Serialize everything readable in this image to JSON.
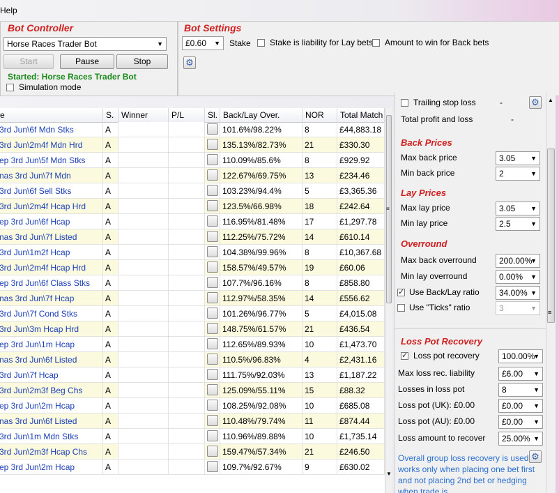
{
  "menu": {
    "help": "Help"
  },
  "bot_controller": {
    "title": "Bot Controller",
    "bot_select": "Horse Races Trader Bot",
    "start": "Start",
    "pause": "Pause",
    "stop": "Stop",
    "status": "Started: Horse Races Trader Bot",
    "simulation": "Simulation mode"
  },
  "bot_settings": {
    "title": "Bot Settings",
    "stake_value": "£0.60",
    "stake_label": "Stake",
    "liability_label": "Stake is liability for Lay bets",
    "amount_label": "Amount to win for Back bets"
  },
  "grid": {
    "headers": [
      "e",
      "S.",
      "Winner",
      "P/L",
      "Sl.",
      "Back/Lay Over.",
      "NOR",
      "Total Match"
    ],
    "rows": [
      {
        "name": "3rd Jun\\6f Mdn Stks",
        "s": "A",
        "over": "101.6%/98.22%",
        "nor": "8",
        "total": "£44,883.18"
      },
      {
        "name": "3rd Jun\\2m4f Mdn Hrd",
        "s": "A",
        "over": "135.13%/82.73%",
        "nor": "21",
        "total": "£330.30"
      },
      {
        "name": "ep 3rd Jun\\5f Mdn Stks",
        "s": "A",
        "over": "110.09%/85.6%",
        "nor": "8",
        "total": "£929.92"
      },
      {
        "name": "nas 3rd Jun\\7f Mdn",
        "s": "A",
        "over": "122.67%/69.75%",
        "nor": "13",
        "total": "£234.46"
      },
      {
        "name": "3rd Jun\\6f Sell Stks",
        "s": "A",
        "over": "103.23%/94.4%",
        "nor": "5",
        "total": "£3,365.36"
      },
      {
        "name": "3rd Jun\\2m4f Hcap Hrd",
        "s": "A",
        "over": "123.5%/66.98%",
        "nor": "18",
        "total": "£242.64"
      },
      {
        "name": "ep 3rd Jun\\6f Hcap",
        "s": "A",
        "over": "116.95%/81.48%",
        "nor": "17",
        "total": "£1,297.78"
      },
      {
        "name": "nas 3rd Jun\\7f Listed",
        "s": "A",
        "over": "112.25%/75.72%",
        "nor": "14",
        "total": "£610.14"
      },
      {
        "name": "3rd Jun\\1m2f Hcap",
        "s": "A",
        "over": "104.38%/99.96%",
        "nor": "8",
        "total": "£10,367.68"
      },
      {
        "name": "3rd Jun\\2m4f Hcap Hrd",
        "s": "A",
        "over": "158.57%/49.57%",
        "nor": "19",
        "total": "£60.06"
      },
      {
        "name": "ep 3rd Jun\\6f Class Stks",
        "s": "A",
        "over": "107.7%/96.16%",
        "nor": "8",
        "total": "£858.80"
      },
      {
        "name": "nas 3rd Jun\\7f Hcap",
        "s": "A",
        "over": "112.97%/58.35%",
        "nor": "14",
        "total": "£556.62"
      },
      {
        "name": "3rd Jun\\7f Cond Stks",
        "s": "A",
        "over": "101.26%/96.77%",
        "nor": "5",
        "total": "£4,015.08"
      },
      {
        "name": "3rd Jun\\3m Hcap Hrd",
        "s": "A",
        "over": "148.75%/61.57%",
        "nor": "21",
        "total": "£436.54"
      },
      {
        "name": "ep 3rd Jun\\1m Hcap",
        "s": "A",
        "over": "112.65%/89.93%",
        "nor": "10",
        "total": "£1,473.70"
      },
      {
        "name": "nas 3rd Jun\\6f Listed",
        "s": "A",
        "over": "110.5%/96.83%",
        "nor": "4",
        "total": "£2,431.16"
      },
      {
        "name": "3rd Jun\\7f Hcap",
        "s": "A",
        "over": "111.75%/92.03%",
        "nor": "13",
        "total": "£1,187.22"
      },
      {
        "name": "3rd Jun\\2m3f Beg Chs",
        "s": "A",
        "over": "125.09%/55.11%",
        "nor": "15",
        "total": "£88.32"
      },
      {
        "name": "ep 3rd Jun\\2m Hcap",
        "s": "A",
        "over": "108.25%/92.08%",
        "nor": "10",
        "total": "£685.08"
      },
      {
        "name": "nas 3rd Jun\\6f Listed",
        "s": "A",
        "over": "110.48%/79.74%",
        "nor": "11",
        "total": "£874.44"
      },
      {
        "name": "3rd Jun\\1m Mdn Stks",
        "s": "A",
        "over": "110.96%/89.88%",
        "nor": "10",
        "total": "£1,735.14"
      },
      {
        "name": "3rd Jun\\2m3f Hcap Chs",
        "s": "A",
        "over": "159.47%/57.34%",
        "nor": "21",
        "total": "£246.50"
      },
      {
        "name": "ep 3rd Jun\\2m Hcap",
        "s": "A",
        "over": "109.7%/92.67%",
        "nor": "9",
        "total": "£630.02"
      }
    ]
  },
  "right": {
    "trailing": "Trailing stop loss",
    "trailing_value": "-",
    "total_profit": "Total profit and loss",
    "total_value": "-",
    "back_prices": "Back Prices",
    "max_back": "Max back price",
    "max_back_val": "3.05",
    "min_back": "Min back price",
    "min_back_val": "2",
    "lay_prices": "Lay Prices",
    "max_lay": "Max lay price",
    "max_lay_val": "3.05",
    "min_lay": "Min lay price",
    "min_lay_val": "2.5",
    "overround": "Overround",
    "max_over": "Max back overround",
    "max_over_val": "200.00%",
    "min_over": "Min lay overround",
    "min_over_val": "0.00%",
    "use_bl": "Use Back/Lay ratio",
    "use_bl_val": "34.00%",
    "use_ticks": "Use \"Ticks\" ratio",
    "use_ticks_val": "3",
    "loss_pot": "Loss Pot Recovery",
    "lp_rec": "Loss pot recovery",
    "lp_rec_val": "100.00%",
    "max_loss": "Max loss rec. liability",
    "max_loss_val": "£6.00",
    "losses_in": "Losses in loss pot",
    "losses_in_val": "8",
    "lp_uk": "Loss pot (UK):",
    "lp_uk_amt": "£0.00",
    "lp_uk_val": "£0.00",
    "lp_au": "Loss pot (AU):",
    "lp_au_amt": "£0.00",
    "lp_au_val": "£0.00",
    "loss_amount": "Loss amount to recover",
    "loss_amount_val": "25.00%",
    "info": "Overall group loss recovery is used, it works only when placing one bet first and not placing 2nd bet or hedging when trade is"
  }
}
